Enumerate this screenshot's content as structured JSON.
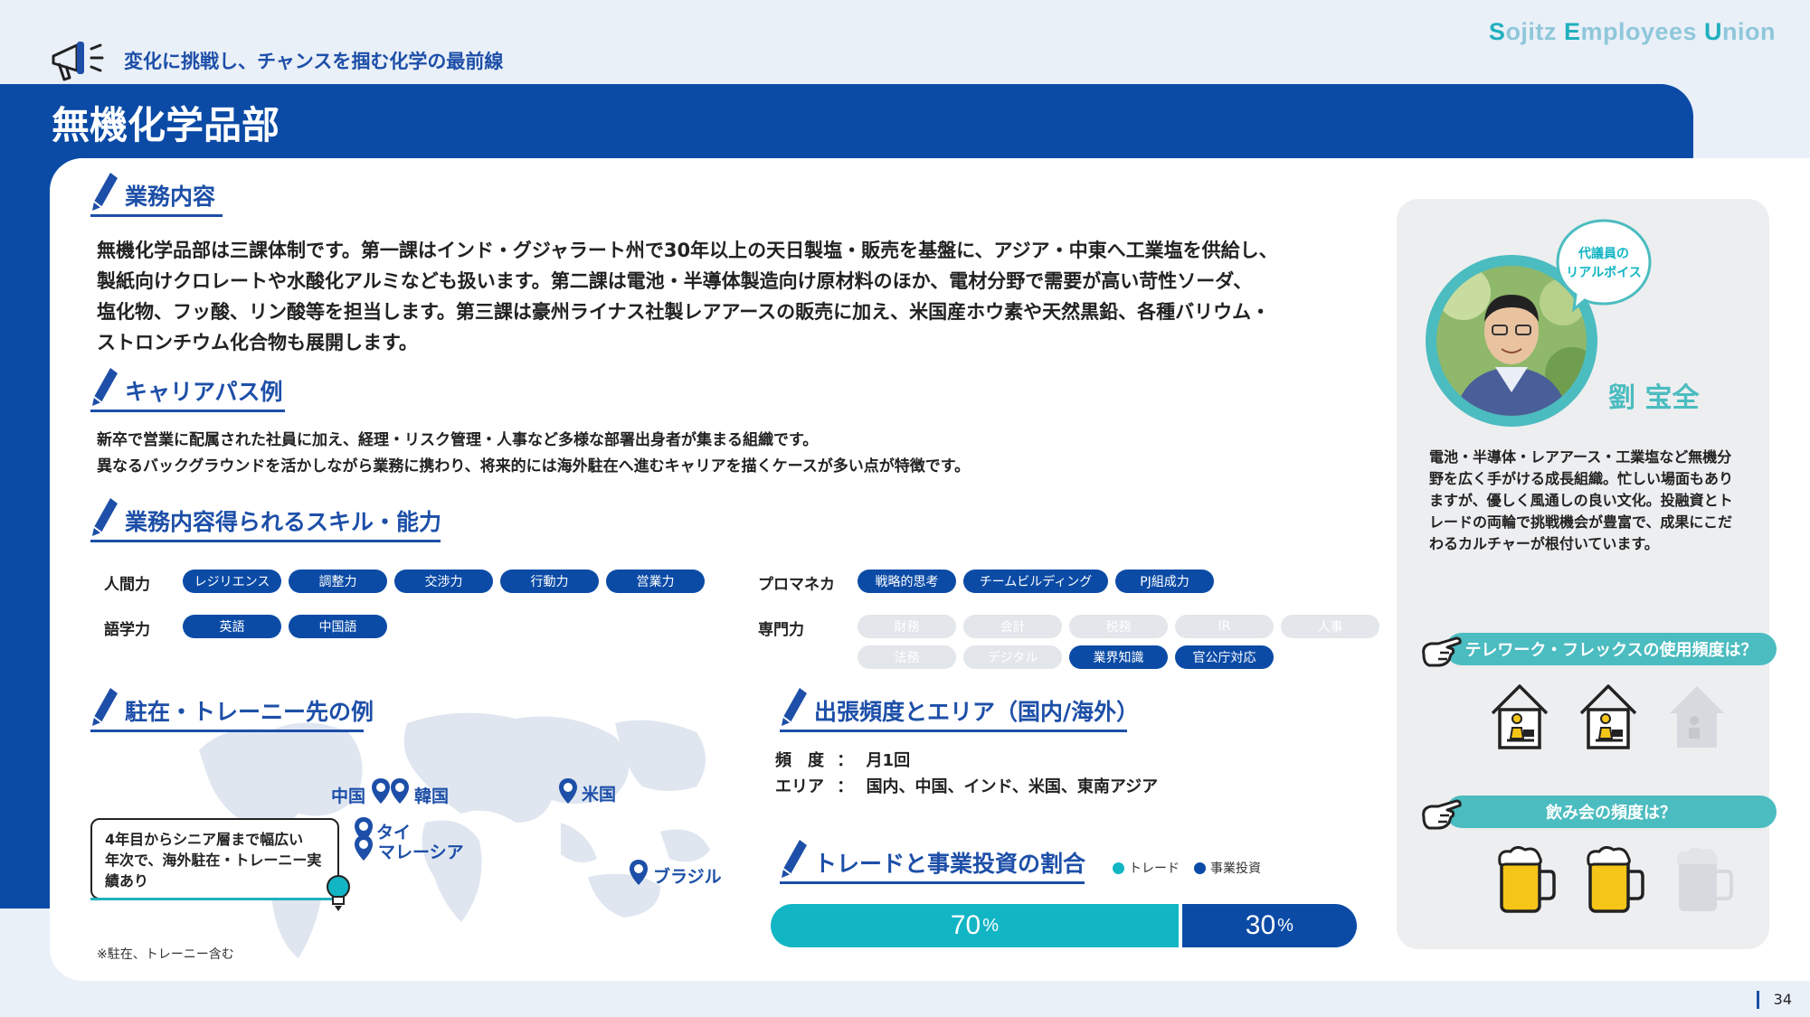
{
  "header": {
    "tagline": "変化に挑戦し、チャンスを掴む化学の最前線",
    "brand_parts": [
      "S",
      "ojitz ",
      "E",
      "mployees ",
      "U",
      "nion"
    ],
    "megaphone_icon": "megaphone-icon"
  },
  "department": {
    "title": "無機化学品部"
  },
  "sections": {
    "business": {
      "heading": "業務内容",
      "lines": [
        "無機化学品部は三課体制です。第一課はインド・グジャラート州で30年以上の天日製塩・販売を基盤に、アジア・中東へ工業塩を供給し、",
        "製紙向けクロレートや水酸化アルミなども扱います。第二課は電池・半導体製造向け原材料のほか、電材分野で需要が高い苛性ソーダ、",
        "塩化物、フッ酸、リン酸等を担当します。第三課は豪州ライナス社製レアアースの販売に加え、米国産ホウ素や天然黒鉛、各種バリウム・",
        "ストロンチウム化合物も展開します。"
      ]
    },
    "career": {
      "heading": "キャリアパス例",
      "lines": [
        "新卒で営業に配属された社員に加え、経理・リスク管理・人事など多様な部署出身者が集まる組織です。",
        "異なるバックグラウンドを活かしながら業務に携わり、将来的には海外駐在へ進むキャリアを描くケースが多い点が特徴です。"
      ]
    },
    "skills": {
      "heading": "業務内容得られるスキル・能力",
      "human": {
        "label": "人間力",
        "items": [
          "レジリエンス",
          "調整力",
          "交渉力",
          "行動力",
          "営業力"
        ]
      },
      "language": {
        "label": "語学力",
        "items": [
          "英語",
          "中国語"
        ]
      },
      "pm": {
        "label": "プロマネカ",
        "items": [
          "戦略的思考",
          "チームビルディング",
          "PJ組成力"
        ]
      },
      "expertise": {
        "label": "専門力",
        "items": [
          {
            "text": "財務",
            "active": false
          },
          {
            "text": "会計",
            "active": false
          },
          {
            "text": "税務",
            "active": false
          },
          {
            "text": "IR",
            "active": false
          },
          {
            "text": "人事",
            "active": false
          },
          {
            "text": "法務",
            "active": false
          },
          {
            "text": "デジタル",
            "active": false
          },
          {
            "text": "業界知識",
            "active": true
          },
          {
            "text": "官公庁対応",
            "active": true
          }
        ]
      }
    },
    "posts": {
      "heading": "駐在・トレーニー先の例",
      "locations": [
        "中国",
        "韓国",
        "米国",
        "タイ",
        "マレーシア",
        "ブラジル"
      ],
      "note": [
        "4年目からシニア層まで幅広い",
        "年次で、海外駐在・トレーニー実",
        "績あり"
      ],
      "footnote": "※駐在、トレーニー含む"
    },
    "trips": {
      "heading": "出張頻度とエリア（国内/海外）",
      "frequency_label": "頻　度",
      "frequency_value": "月1回",
      "area_label": "エリア",
      "area_value": "国内、中国、インド、米国、東南アジア",
      "separator": "："
    },
    "ratio": {
      "heading": "トレードと事業投資の割合",
      "legend": [
        "トレード",
        "事業投資"
      ],
      "trade": {
        "value": 70,
        "label": "70",
        "unit": "%",
        "color": "#12b5c4"
      },
      "investment": {
        "value": 30,
        "label": "30",
        "unit": "%",
        "color": "#0b4ba6"
      }
    }
  },
  "representative": {
    "bubble_line1": "代議員の",
    "bubble_line2": "リアルボイス",
    "name": "劉 宝全",
    "comment": "電池・半導体・レアアース・工業塩など無機分野を広く手がける成長組織。忙しい場面もありますが、優しく風通しの良い文化。投融資とトレードの両輪で挑戦機会が豊富で、成果にこだわるカルチャーが根付いています。"
  },
  "questions": {
    "telework": {
      "label": "テレワーク・フレックスの使用頻度は？",
      "level": 2,
      "max": 3,
      "icon": "home-office-icon"
    },
    "drinking": {
      "label": "飲み会の頻度は？",
      "level": 2,
      "max": 3,
      "icon": "beer-mug-icon"
    }
  },
  "colors": {
    "navy": "#0b4ba6",
    "teal": "#12b5c4",
    "mint": "#4bbcc0"
  },
  "page_number": "34"
}
